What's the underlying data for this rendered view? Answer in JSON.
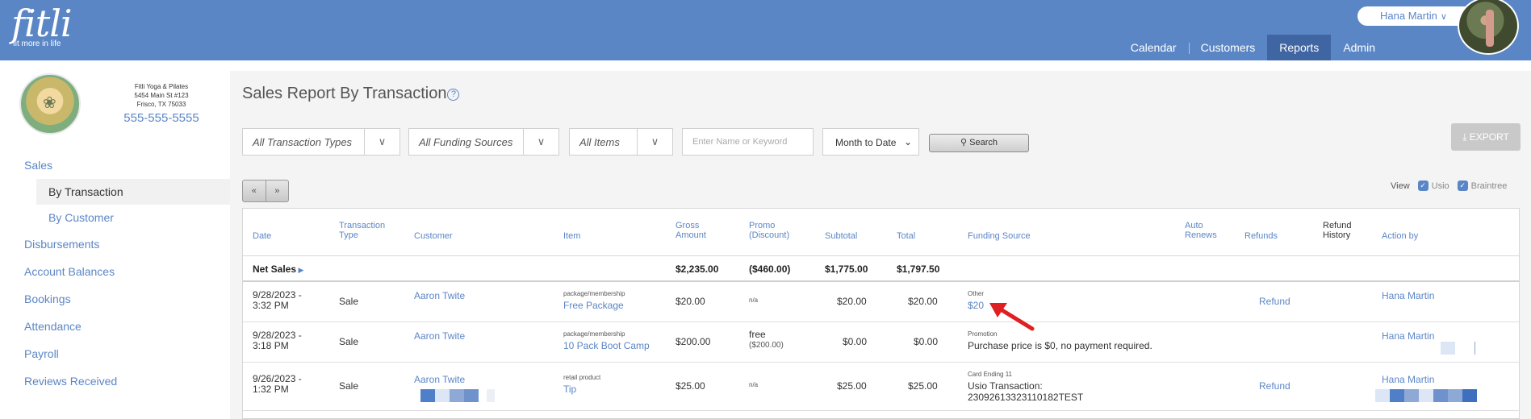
{
  "header": {
    "logo_text": "fitli",
    "logo_tagline": "fit more in life",
    "user_name": "Hana Martin",
    "nav": [
      "Calendar",
      "Customers",
      "Reports",
      "Admin"
    ]
  },
  "studio": {
    "name": "Fitli Yoga & Pilates",
    "address1": "5454 Main St #123",
    "address2": "Frisco, TX 75033",
    "phone": "555-555-5555"
  },
  "sidebar": {
    "sales": "Sales",
    "by_transaction": "By Transaction",
    "by_customer": "By Customer",
    "disbursements": "Disbursements",
    "account_balances": "Account Balances",
    "bookings": "Bookings",
    "attendance": "Attendance",
    "payroll": "Payroll",
    "reviews_received": "Reviews Received"
  },
  "page": {
    "title": "Sales Report By Transaction",
    "help_glyph": "?"
  },
  "filters": {
    "transaction_types": "All Transaction Types",
    "funding_sources": "All Funding Sources",
    "items": "All Items",
    "keyword_placeholder": "Enter Name or Keyword",
    "date_range": "Month to Date",
    "search_label": "Search",
    "export_label": "EXPORT"
  },
  "pager": {
    "prev": "«",
    "next": "»"
  },
  "view": {
    "label": "View",
    "opt1": "Usio",
    "opt2": "Braintree"
  },
  "table": {
    "headers": {
      "date": "Date",
      "transaction_type": "Transaction Type",
      "customer": "Customer",
      "item": "Item",
      "gross_amount": "Gross Amount",
      "promo": "Promo (Discount)",
      "subtotal": "Subtotal",
      "total": "Total",
      "funding_source": "Funding Source",
      "auto_renews": "Auto Renews",
      "refunds": "Refunds",
      "refund_history": "Refund History",
      "action_by": "Action by"
    },
    "net_sales": {
      "label": "Net Sales",
      "gross": "$2,235.00",
      "promo": "($460.00)",
      "subtotal": "$1,775.00",
      "total": "$1,797.50"
    },
    "rows": [
      {
        "date_line1": "9/28/2023 -",
        "date_line2": "3:32 PM",
        "type": "Sale",
        "customer": "Aaron Twite",
        "item_type": "package/membership",
        "item_name": "Free Package",
        "gross": "$20.00",
        "promo": "n/a",
        "promo_sub": "",
        "subtotal": "$20.00",
        "total": "$20.00",
        "funding_label": "Other",
        "funding_value": "$20",
        "refund": "Refund",
        "action_by": "Hana Martin"
      },
      {
        "date_line1": "9/28/2023 -",
        "date_line2": "3:18 PM",
        "type": "Sale",
        "customer": "Aaron Twite",
        "item_type": "package/membership",
        "item_name": "10 Pack Boot Camp",
        "gross": "$200.00",
        "promo": "free",
        "promo_sub": "($200.00)",
        "subtotal": "$0.00",
        "total": "$0.00",
        "funding_label": "Promotion",
        "funding_value": "Purchase price is $0, no payment required.",
        "refund": "",
        "action_by": "Hana Martin"
      },
      {
        "date_line1": "9/26/2023 -",
        "date_line2": "1:32 PM",
        "type": "Sale",
        "customer": "Aaron Twite",
        "item_type": "retail product",
        "item_name": "Tip",
        "gross": "$25.00",
        "promo": "n/a",
        "promo_sub": "",
        "subtotal": "$25.00",
        "total": "$25.00",
        "funding_label": "Card Ending 11",
        "funding_value": "Usio Transaction:",
        "funding_value2": "23092613323110182TEST",
        "refund": "Refund",
        "action_by": "Hana Martin"
      }
    ]
  },
  "colors": {
    "header_bg": "#5b86c6",
    "nav_active": "#3f65a3",
    "link": "#5b86c6",
    "arrow": "#e02020"
  }
}
